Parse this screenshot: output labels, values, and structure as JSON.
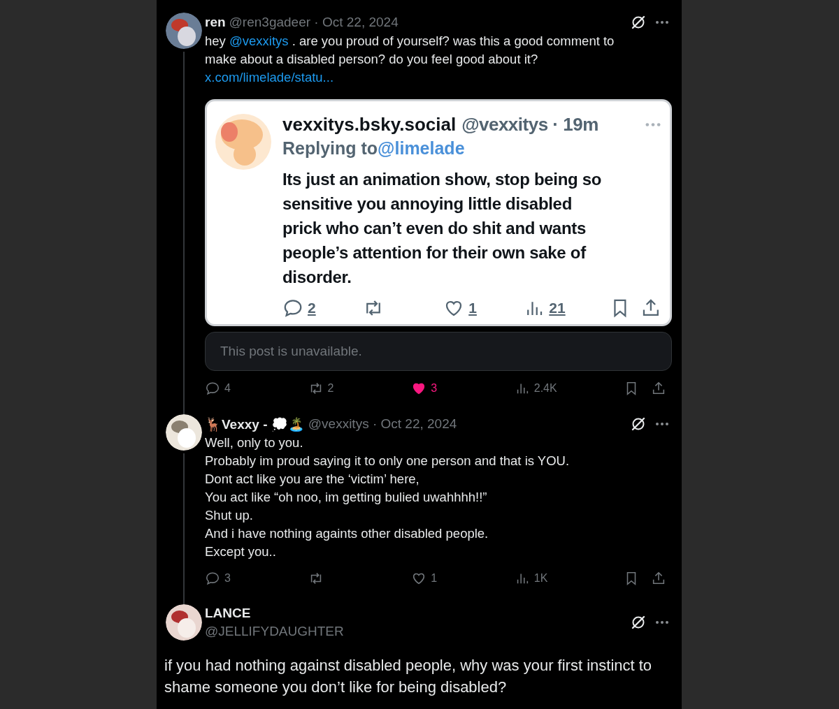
{
  "posts": [
    {
      "kind": "inline",
      "name": "ren",
      "handle": "@ren3gadeer",
      "separator": "·",
      "date": "Oct 22, 2024",
      "lines": [
        [
          {
            "kind": "text",
            "value": "hey "
          },
          {
            "kind": "mention",
            "value": "@vexxitys"
          },
          {
            "kind": "text",
            "value": " . are you proud of yourself? was this a good comment to"
          }
        ],
        [
          {
            "kind": "text",
            "value": "make about a disabled person? do you feel good about it?"
          }
        ],
        [
          {
            "kind": "link",
            "value": "x.com/limelade/statu..."
          }
        ]
      ],
      "quote": {
        "name": "vexxitys.bsky.social",
        "handle": "@vexxitys",
        "separator": "·",
        "time": "19m",
        "replying_label": "Replying to",
        "replying_to": "@limelade",
        "lines": [
          "Its just an animation show, stop being so",
          "sensitive you annoying little disabled",
          "prick who can’t even do shit and wants",
          "people’s attention for their own sake of",
          "disorder."
        ],
        "stats": [
          {
            "kind": "reply",
            "count": "2"
          },
          {
            "kind": "repost"
          },
          {
            "kind": "like",
            "count": "1"
          },
          {
            "kind": "views",
            "count": "21"
          }
        ]
      },
      "unavailable": "This post is unavailable.",
      "stats": [
        {
          "kind": "reply",
          "count": "4"
        },
        {
          "kind": "repost",
          "count": "2"
        },
        {
          "kind": "like",
          "count": "3",
          "on": true
        },
        {
          "kind": "views",
          "count": "2.4K"
        }
      ]
    },
    {
      "kind": "inline",
      "name": "🦌Vexxy - 💭🏝️",
      "handle": "@vexxitys",
      "separator": "·",
      "date": "Oct 22, 2024",
      "lines": [
        [
          {
            "kind": "text",
            "value": "Well, only to you."
          }
        ],
        [
          {
            "kind": "text",
            "value": "Probably im proud saying it to only one person and that is YOU."
          }
        ],
        [
          {
            "kind": "text",
            "value": "Dont act like you are the ‘victim’ here,"
          }
        ],
        [
          {
            "kind": "text",
            "value": "You act like “oh noo, im getting bulied uwahhhh!!”"
          }
        ],
        [
          {
            "kind": "text",
            "value": "Shut up."
          }
        ],
        [
          {
            "kind": "text",
            "value": "And i have nothing againts other disabled people."
          }
        ],
        [
          {
            "kind": "text",
            "value": "Except you.."
          }
        ]
      ],
      "stats": [
        {
          "kind": "reply",
          "count": "3"
        },
        {
          "kind": "repost"
        },
        {
          "kind": "like",
          "count": "1",
          "on": false
        },
        {
          "kind": "views",
          "count": "1K"
        }
      ]
    },
    {
      "kind": "focus",
      "name": "LANCE",
      "handle": "@JELLIFYDAUGHTER",
      "lines": [
        [
          {
            "kind": "text",
            "value": "if you had nothing against disabled people, why was your first instinct to"
          }
        ],
        [
          {
            "kind": "text",
            "value": "shame someone you don’t like for being disabled?"
          }
        ]
      ]
    }
  ]
}
